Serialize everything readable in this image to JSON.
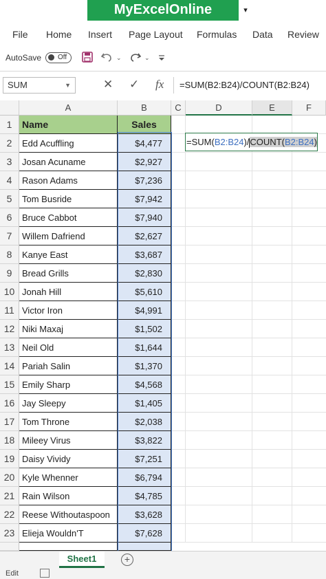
{
  "app": {
    "title": "MyExcelOnline",
    "title_caret": "▾"
  },
  "menu": [
    "File",
    "Home",
    "Insert",
    "Page Layout",
    "Formulas",
    "Data",
    "Review"
  ],
  "quick_access": {
    "autosave_label": "AutoSave",
    "toggle_state": "Off"
  },
  "formula_bar": {
    "name_box": "SUM",
    "cancel_icon": "✕",
    "enter_icon": "✓",
    "fx_label": "fx",
    "formula": "=SUM(B2:B24)/COUNT(B2:B24)"
  },
  "columns": [
    "A",
    "B",
    "C",
    "D",
    "E",
    "F"
  ],
  "header_row": {
    "row": "1",
    "name": "Name",
    "sales": "Sales"
  },
  "rows": [
    {
      "row": "2",
      "name": "Edd Acuffling",
      "sales": "$4,477"
    },
    {
      "row": "3",
      "name": "Josan Acuname",
      "sales": "$2,927"
    },
    {
      "row": "4",
      "name": "Rason Adams",
      "sales": "$7,236"
    },
    {
      "row": "5",
      "name": "Tom Busride",
      "sales": "$7,942"
    },
    {
      "row": "6",
      "name": "Bruce Cabbot",
      "sales": "$7,940"
    },
    {
      "row": "7",
      "name": "Willem Dafriend",
      "sales": "$2,627"
    },
    {
      "row": "8",
      "name": "Kanye East",
      "sales": "$3,687"
    },
    {
      "row": "9",
      "name": "Bread Grills",
      "sales": "$2,830"
    },
    {
      "row": "10",
      "name": "Jonah Hill",
      "sales": "$5,610"
    },
    {
      "row": "11",
      "name": "Victor Iron",
      "sales": "$4,991"
    },
    {
      "row": "12",
      "name": "Niki Maxaj",
      "sales": "$1,502"
    },
    {
      "row": "13",
      "name": "Neil Old",
      "sales": "$1,644"
    },
    {
      "row": "14",
      "name": "Pariah Salin",
      "sales": "$1,370"
    },
    {
      "row": "15",
      "name": "Emily Sharp",
      "sales": "$4,568"
    },
    {
      "row": "16",
      "name": "Jay Sleepy",
      "sales": "$1,405"
    },
    {
      "row": "17",
      "name": "Tom Throne",
      "sales": "$2,038"
    },
    {
      "row": "18",
      "name": "Mileey Virus",
      "sales": "$3,822"
    },
    {
      "row": "19",
      "name": "Daisy Vividy",
      "sales": "$7,251"
    },
    {
      "row": "20",
      "name": "Kyle Whenner",
      "sales": "$6,794"
    },
    {
      "row": "21",
      "name": "Rain Wilson",
      "sales": "$4,785"
    },
    {
      "row": "22",
      "name": "Reese Withoutaspoon",
      "sales": "$3,628"
    },
    {
      "row": "23",
      "name": "Elieja Wouldn'T",
      "sales": "$7,628"
    }
  ],
  "editing_cell": {
    "column": "D",
    "row": "2",
    "prefix": "=SUM(",
    "ref1": "B2:B24",
    "mid": ")/",
    "fn": "COUNT(",
    "ref2": "B2:B24",
    "suffix": ")"
  },
  "sheet_tabs": {
    "active": "Sheet1",
    "add_icon": "+"
  },
  "status": {
    "mode": "Edit"
  },
  "colors": {
    "title_green": "#20a050",
    "header_fill": "#a8d08d",
    "sales_fill": "#dce6f5",
    "ref_blue": "#3d6fc0",
    "tab_green": "#217346"
  }
}
